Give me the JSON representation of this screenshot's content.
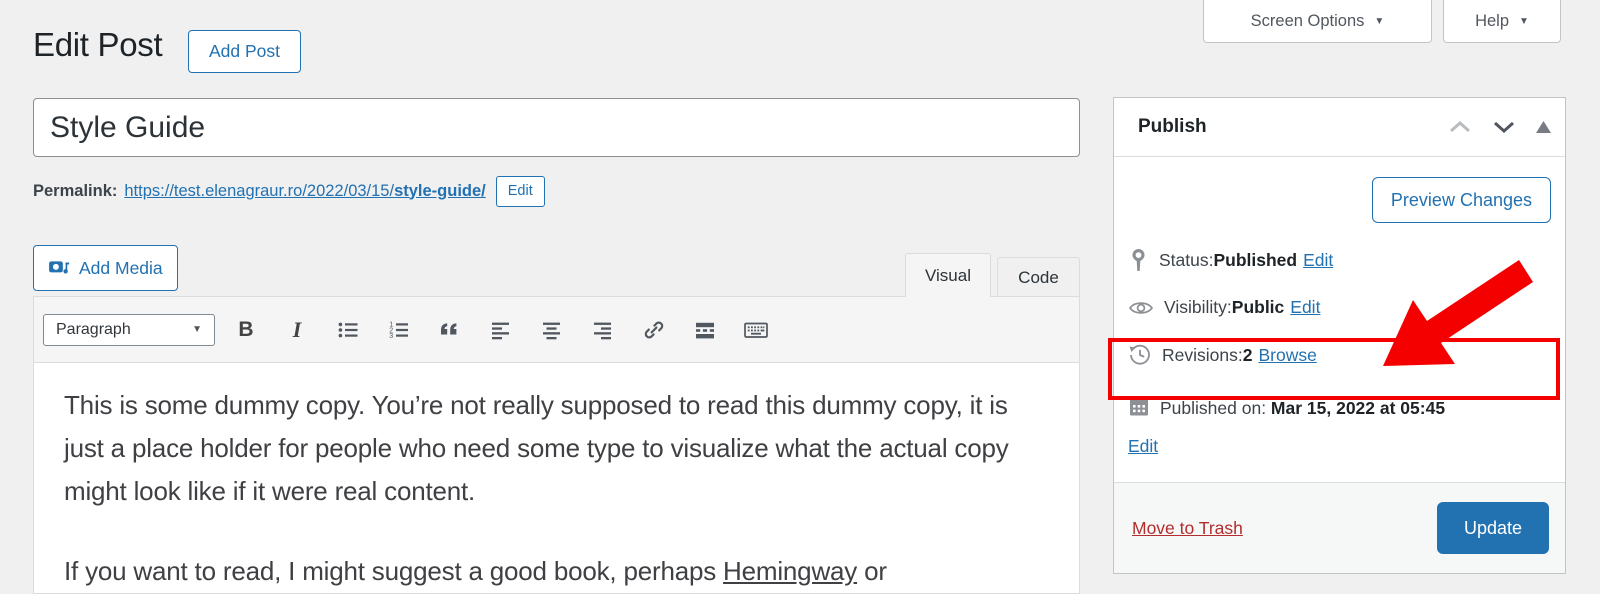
{
  "colors": {
    "page_background": "#f0f0f1",
    "accent_blue": "#2271b1",
    "danger_red": "#b32d2e",
    "annotation_red": "#f40000"
  },
  "screen_meta": {
    "screen_options_label": "Screen Options",
    "help_label": "Help",
    "caret": "▼"
  },
  "header": {
    "page_title": "Edit Post",
    "add_post_label": "Add Post"
  },
  "post": {
    "title_value": "Style Guide"
  },
  "permalink": {
    "label": "Permalink:",
    "url_base": "https://test.elenagraur.ro/2022/03/15/",
    "url_slug": "style-guide/",
    "edit_label": "Edit"
  },
  "media": {
    "add_media_label": "Add Media"
  },
  "editor": {
    "tabs": [
      {
        "label": "Visual",
        "active": true
      },
      {
        "label": "Code",
        "active": false
      }
    ],
    "toolbar": {
      "block_format": "Paragraph",
      "caret": "▼",
      "bold_glyph": "B",
      "italic_glyph": "I",
      "icons": [
        "bold",
        "italic",
        "bulleted-list",
        "numbered-list",
        "blockquote",
        "align-left",
        "align-center",
        "align-right",
        "link",
        "more-tag",
        "keyboard-shortcuts"
      ]
    },
    "content": {
      "paragraph1": "This is some dummy copy. You’re not really supposed to read this dummy copy, it is just a place holder for people who need some type to visualize what the actual copy might look like if it were real content.",
      "paragraph2_before": "If you want to read, I might suggest a good book, perhaps ",
      "paragraph2_link": "Hemingway",
      "paragraph2_after": " or"
    }
  },
  "publish_panel": {
    "title": "Publish",
    "preview_button_label": "Preview Changes",
    "status": {
      "label": "Status: ",
      "value": "Published",
      "action": "Edit"
    },
    "visibility": {
      "label": "Visibility: ",
      "value": "Public",
      "action": "Edit"
    },
    "revisions": {
      "label": "Revisions: ",
      "value": "2",
      "action": "Browse"
    },
    "published_on": {
      "label": "Published on: ",
      "value": "Mar 15, 2022 at 05:45",
      "action": "Edit"
    },
    "move_to_trash_label": "Move to Trash",
    "update_button_label": "Update"
  },
  "annotation": {
    "highlight_target": "revisions-row",
    "color": "#f40000",
    "shape": "rectangle-and-arrow"
  }
}
